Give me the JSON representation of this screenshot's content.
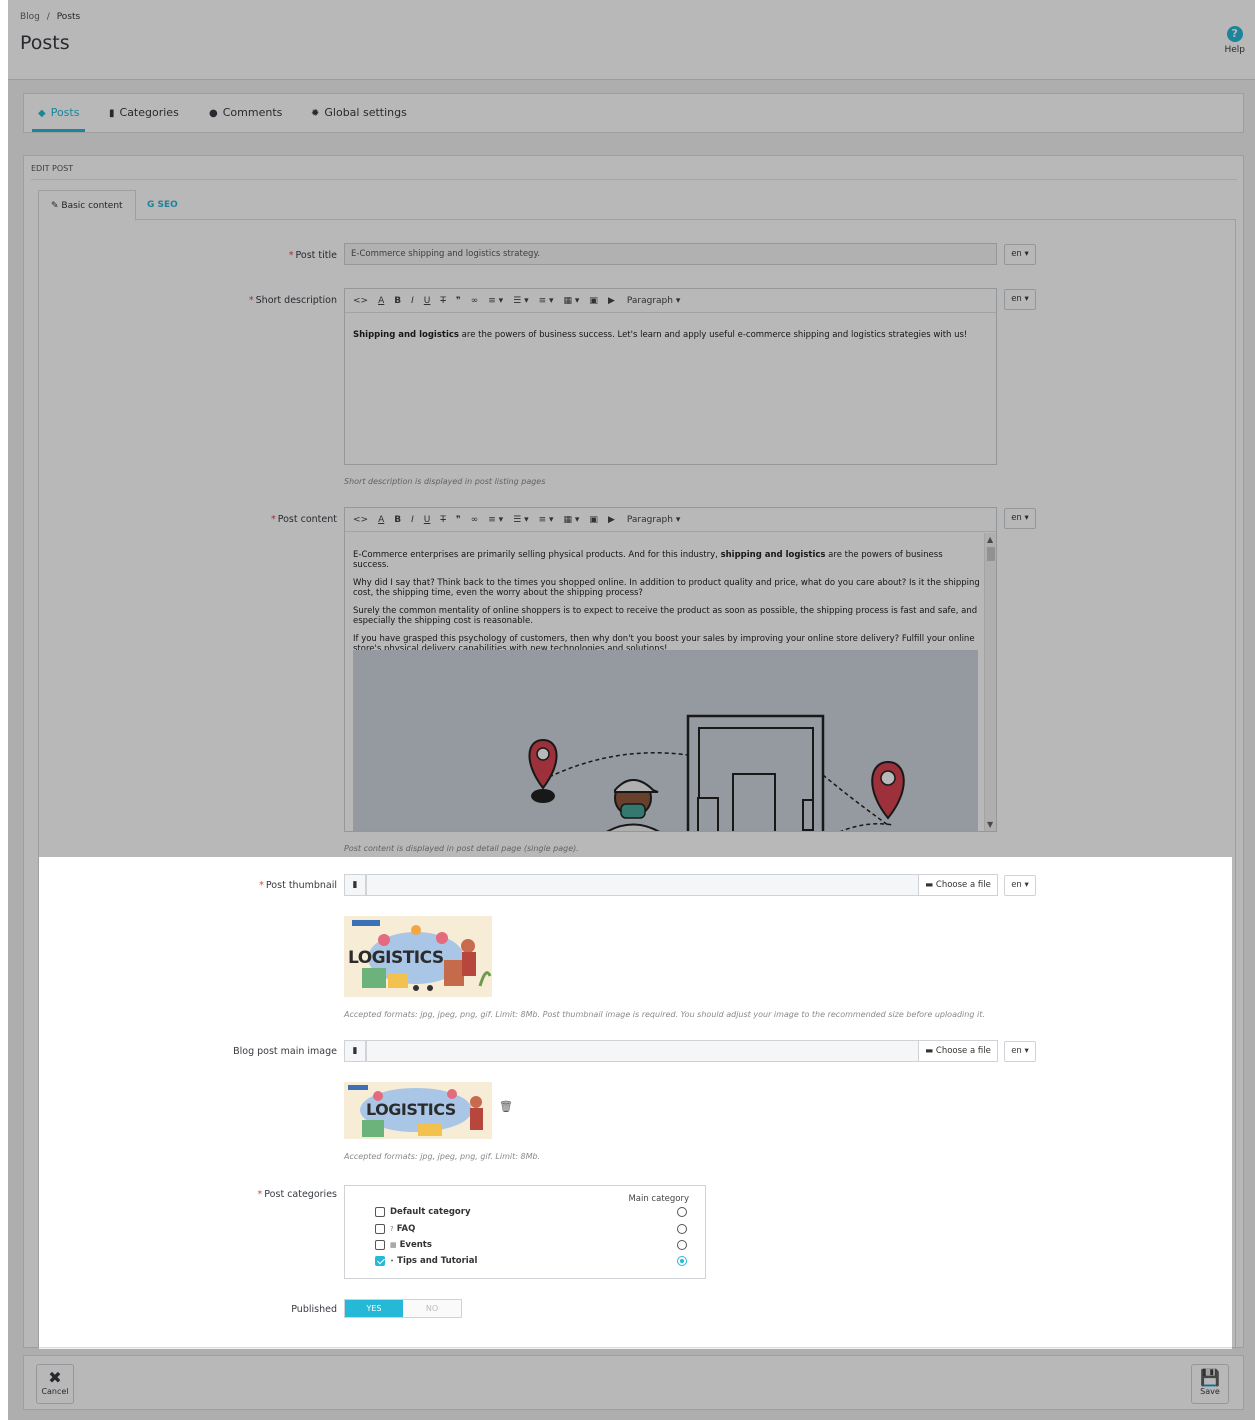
{
  "breadcrumb": {
    "parent": "Blog",
    "separator": "/",
    "current": "Posts"
  },
  "page_title": "Posts",
  "help_label": "Help",
  "main_tabs": [
    {
      "label": "Posts",
      "icon": "tag-icon",
      "active": true
    },
    {
      "label": "Categories",
      "icon": "book-icon",
      "active": false
    },
    {
      "label": "Comments",
      "icon": "comments-icon",
      "active": false
    },
    {
      "label": "Global settings",
      "icon": "gear-icon",
      "active": false
    }
  ],
  "panel_heading": "EDIT POST",
  "sub_tabs": [
    {
      "label": "Basic content",
      "icon": "edit-icon",
      "active": true
    },
    {
      "label": "SEO",
      "icon": "google-icon",
      "active": false
    }
  ],
  "lang_label": "en",
  "form": {
    "post_title": {
      "label": "Post title",
      "value": "E-Commerce shipping and logistics strategy."
    },
    "short_description": {
      "label": "Short description",
      "bold": "Shipping and logistics",
      "text": " are the powers of business success. Let's learn and apply useful e-commerce shipping and logistics strategies with us!",
      "hint": "Short description is displayed in post listing pages"
    },
    "post_content": {
      "label": "Post content",
      "p1_before": "E-Commerce enterprises are primarily selling physical products. And for this industry, ",
      "p1_bold": "shipping and logistics",
      "p1_after": " are the powers of business success.",
      "p2": "Why did I say that? Think back to the times you shopped online. In addition to product quality and price, what do you care about? Is it the shipping cost, the shipping time, even the worry about the shipping process?",
      "p3": "Surely the common mentality of online shoppers is to expect to receive the product as soon as possible, the shipping process is fast and safe, and especially the shipping cost is reasonable.",
      "p4": "If you have grasped this psychology of customers, then why don't you boost your sales by improving your online store delivery? Fulfill your online store's physical delivery capabilities with new technologies and solutions!",
      "hint": "Post content is displayed in post detail page (single page)."
    },
    "toolbar_paragraph": "Paragraph",
    "post_thumbnail": {
      "label": "Post thumbnail",
      "choose": "Choose a file",
      "image_text": "LOGISTICS",
      "hint": "Accepted formats: jpg, jpeg, png, gif. Limit: 8Mb. Post thumbnail image is required. You should adjust your image to the recommended size before uploading it."
    },
    "main_image": {
      "label": "Blog post main image",
      "choose": "Choose a file",
      "image_text": "LOGISTICS",
      "hint": "Accepted formats: jpg, jpeg, png, gif. Limit: 8Mb."
    },
    "categories": {
      "label": "Post categories",
      "main_header": "Main category",
      "items": [
        {
          "name": "Default category",
          "checked": false,
          "main": false
        },
        {
          "name": "FAQ",
          "checked": false,
          "main": false
        },
        {
          "name": "Events",
          "checked": false,
          "main": false
        },
        {
          "name": "Tips and Tutorial",
          "checked": true,
          "main": true
        }
      ]
    },
    "published": {
      "label": "Published",
      "yes": "YES",
      "no": "NO",
      "value": true
    }
  },
  "footer": {
    "cancel": "Cancel",
    "save": "Save"
  },
  "colors": {
    "accent": "#25b9d7",
    "required": "#e0443f"
  }
}
